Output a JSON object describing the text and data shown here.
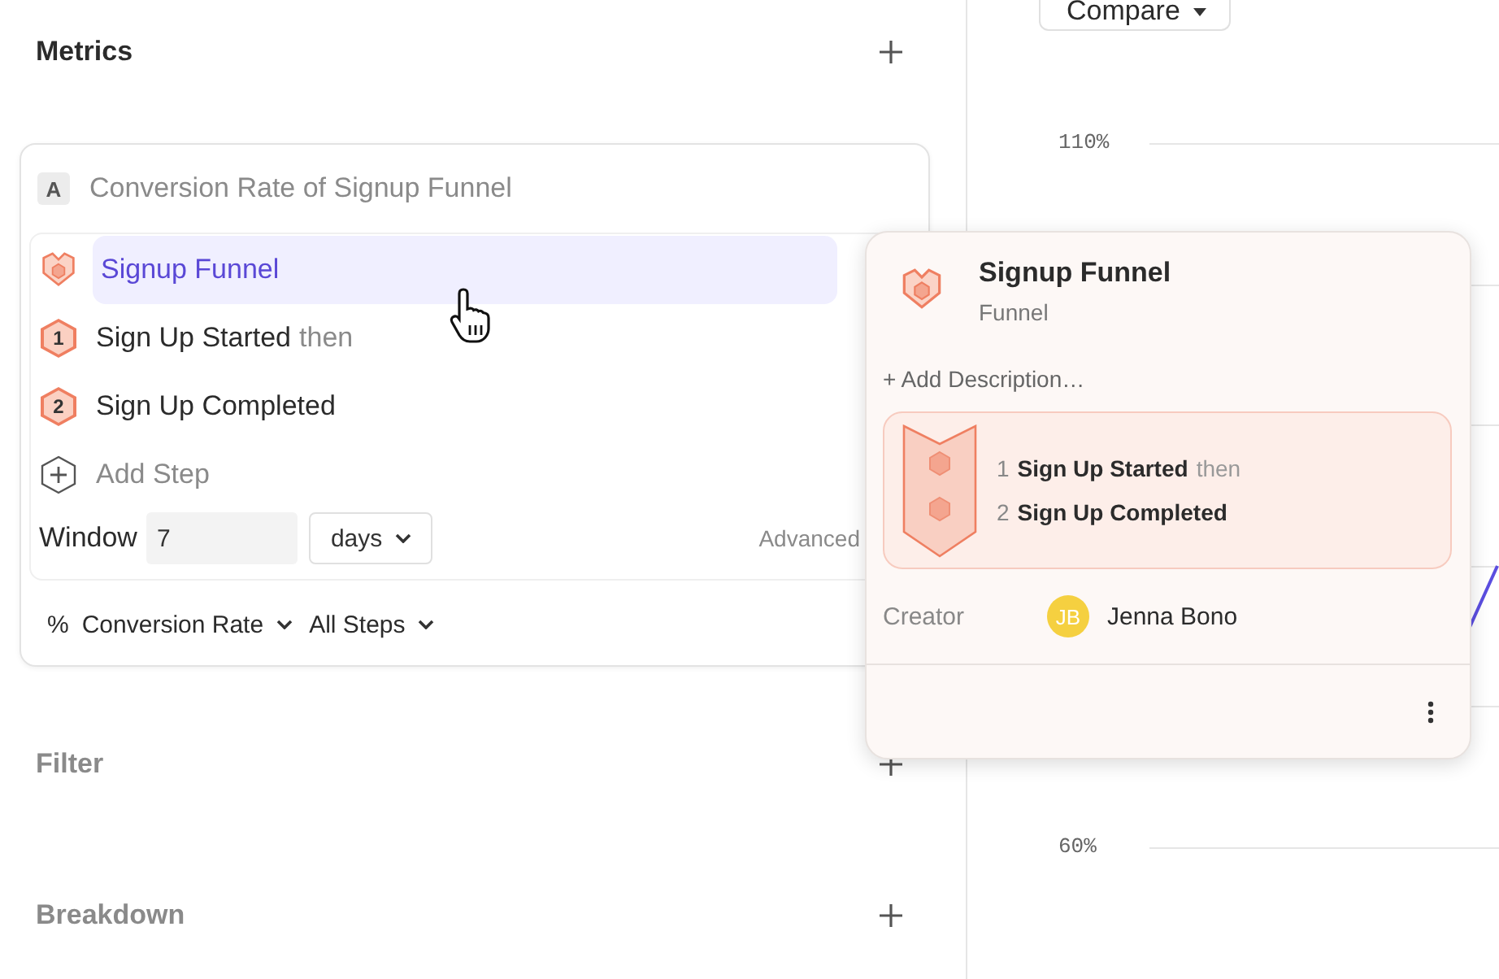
{
  "metrics": {
    "title": "Metrics"
  },
  "metric": {
    "letter": "A",
    "name": "Conversion Rate of Signup Funnel",
    "funnel": {
      "name": "Signup Funnel",
      "highlighted": true
    },
    "steps": [
      {
        "number": "1",
        "name": "Sign Up Started",
        "connector": "then"
      },
      {
        "number": "2",
        "name": "Sign Up Completed"
      }
    ],
    "add_step": "Add Step",
    "window": {
      "label": "Window",
      "value": "7",
      "unit": "days"
    },
    "advanced": "Advanced",
    "measure": {
      "symbol": "%",
      "label": "Conversion Rate"
    },
    "steps_filter": "All Steps"
  },
  "sections": [
    {
      "title": "Filter"
    },
    {
      "title": "Breakdown"
    }
  ],
  "compare": "Compare",
  "chart": {
    "y_labels": [
      "110%",
      "60%"
    ]
  },
  "popover": {
    "title": "Signup Funnel",
    "type": "Funnel",
    "add_description": "+ Add Description…",
    "steps": [
      {
        "number": "1",
        "name": "Sign Up Started",
        "connector": "then"
      },
      {
        "number": "2",
        "name": "Sign Up Completed"
      }
    ],
    "creator_label": "Creator",
    "creator": {
      "initials": "JB",
      "name": "Jenna Bono"
    }
  }
}
